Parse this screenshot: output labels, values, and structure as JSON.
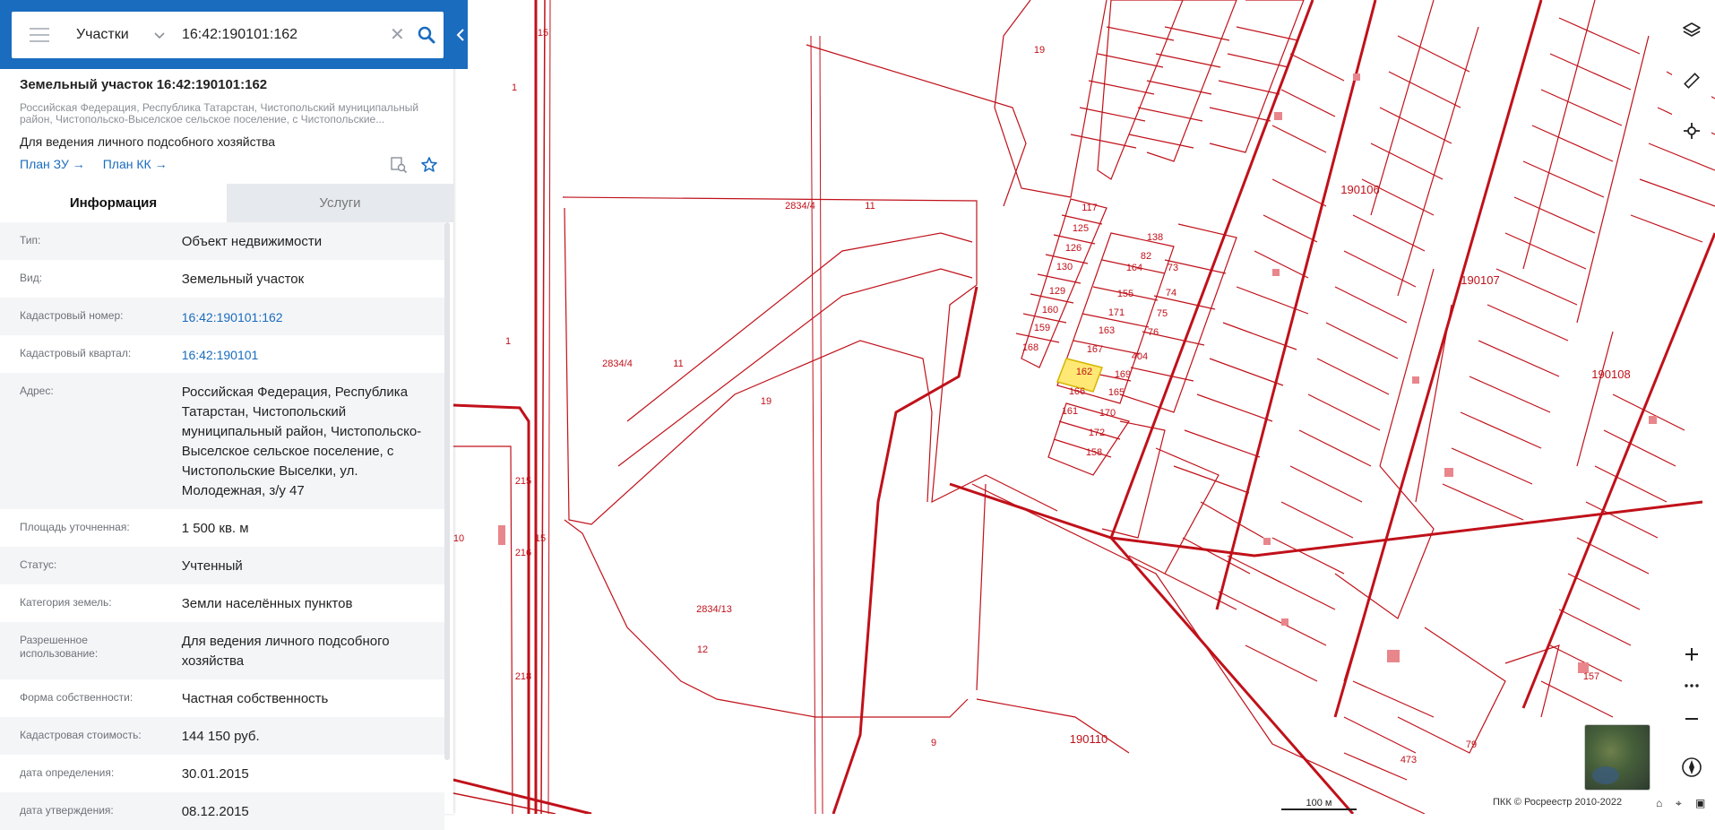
{
  "search": {
    "type_label": "Участки",
    "query": "16:42:190101:162"
  },
  "parcel": {
    "title": "Земельный участок 16:42:190101:162",
    "address_short": "Российская Федерация, Республика Татарстан, Чистопольский муниципальный район, Чистопольско-Выселское сельское поселение, с Чистопольские...",
    "usage": "Для ведения личного подсобного хозяйства",
    "link_plan_zu": "План ЗУ →",
    "link_plan_kk": "План КК →"
  },
  "tabs": [
    {
      "label": "Информация"
    },
    {
      "label": "Услуги"
    }
  ],
  "properties": [
    {
      "label": "Тип:",
      "value": "Объект недвижимости"
    },
    {
      "label": "Вид:",
      "value": "Земельный участок"
    },
    {
      "label": "Кадастровый номер:",
      "value": "16:42:190101:162"
    },
    {
      "label": "Кадастровый квартал:",
      "value": "16:42:190101"
    },
    {
      "label": "Адрес:",
      "value": "Российская Федерация, Республика Татарстан, Чистопольский муниципальный район, Чистопольско-Выселское сельское поселение, с Чистопольские Выселки, ул. Молодежная, з/у 47"
    },
    {
      "label": "Площадь уточненная:",
      "value": "1 500 кв. м"
    },
    {
      "label": "Статус:",
      "value": "Учтенный"
    },
    {
      "label": "Категория земель:",
      "value": "Земли населённых пунктов"
    },
    {
      "label": "Разрешенное использование:",
      "value": "Для ведения личного подсобного хозяйства"
    },
    {
      "label": "Форма собственности:",
      "value": "Частная собственность"
    },
    {
      "label": "Кадастровая стоимость:",
      "value": "144 150 руб."
    },
    {
      "label": "дата определения:",
      "value": "30.01.2015"
    },
    {
      "label": "дата утверждения:",
      "value": "08.12.2015"
    }
  ],
  "map": {
    "scale_label": "100 м",
    "copyright": "ПКК © Росреестр 2010-2022",
    "quarter_labels": [
      "190106",
      "190107",
      "190108",
      "190110"
    ],
    "parcel_labels": [
      "2834/4",
      "2834/4",
      "2834/13",
      "11",
      "11",
      "19",
      "19",
      "1",
      "1",
      "12",
      "9",
      "10",
      "15",
      "15",
      "215",
      "216",
      "218",
      "473",
      "157",
      "79"
    ],
    "lot_labels": [
      "117",
      "125",
      "126",
      "130",
      "129",
      "160",
      "159",
      "168",
      "167",
      "163",
      "171",
      "155",
      "164",
      "138",
      "82",
      "73",
      "74",
      "75",
      "76",
      "404",
      "169",
      "165",
      "170",
      "172",
      "158",
      "166",
      "161",
      "162"
    ],
    "colors": {
      "boundary": "#c0111a",
      "highlight_fill": "#ffe873",
      "link": "#1a6cbf",
      "header": "#1a6cbf"
    }
  }
}
